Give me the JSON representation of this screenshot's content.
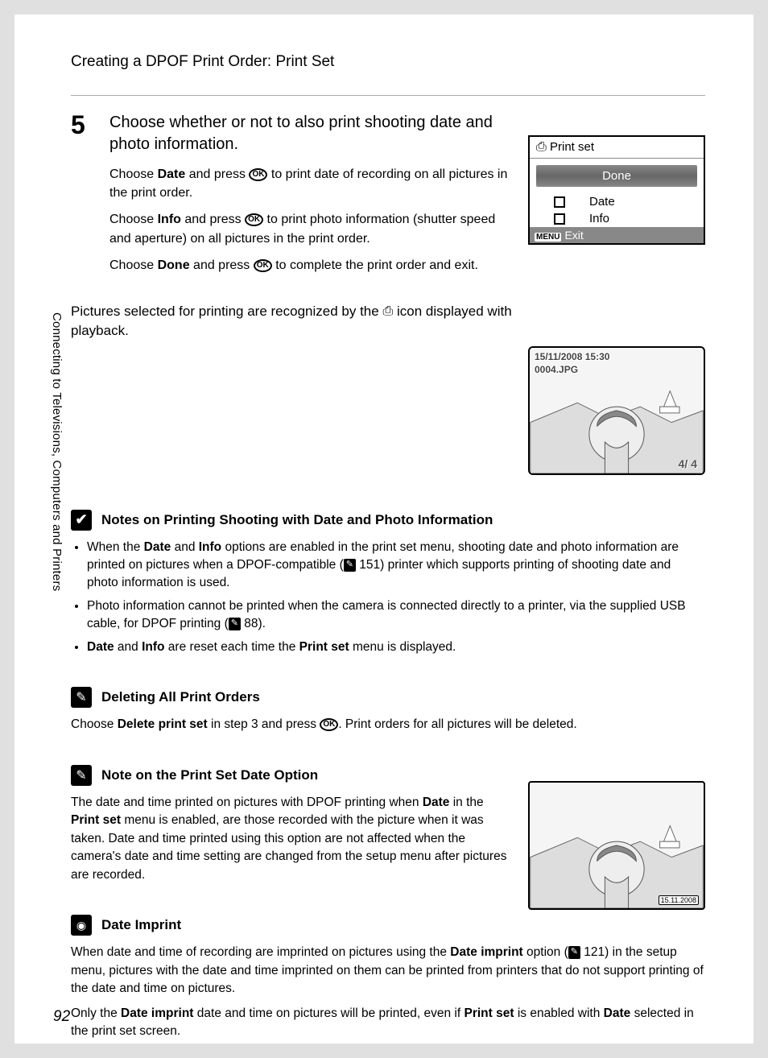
{
  "header": {
    "title": "Creating a DPOF Print Order: Print Set"
  },
  "sidebar": {
    "label": "Connecting to Televisions, Computers and Printers"
  },
  "step": {
    "number": "5",
    "title": "Choose whether or not to also print shooting date and photo information.",
    "p1_a": "Choose ",
    "p1_b": "Date",
    "p1_c": " and press ",
    "p1_d": " to print date of recording on all pictures in the print order.",
    "p2_a": "Choose ",
    "p2_b": "Info",
    "p2_c": " and press ",
    "p2_d": " to print photo information (shutter speed and aperture) on all pictures in the print order.",
    "p3_a": "Choose ",
    "p3_b": "Done",
    "p3_c": " and press ",
    "p3_d": " to complete the print order and exit."
  },
  "mini": {
    "title": "Print set",
    "done": "Done",
    "date": "Date",
    "info": "Info",
    "exit": "Exit",
    "menu": "MENU"
  },
  "playback_text_a": "Pictures selected for printing are recognized by the ",
  "playback_text_b": " icon displayed with playback.",
  "playback_overlay": {
    "date": "15/11/2008 15:30",
    "file": "0004.JPG",
    "counter": "4/    4"
  },
  "notes1": {
    "heading": "Notes on Printing Shooting with Date and Photo Information",
    "li1_a": "When the ",
    "li1_b": "Date",
    "li1_c": " and ",
    "li1_d": "Info",
    "li1_e": " options are enabled in the print set menu, shooting date and photo information are printed on pictures when a DPOF-compatible (",
    "li1_ref": "151",
    "li1_f": ") printer which supports printing of shooting date and photo information is used.",
    "li2_a": "Photo information cannot be printed when the camera is connected directly to a printer, via the supplied USB cable, for DPOF printing (",
    "li2_ref": "88",
    "li2_b": ").",
    "li3_a": "Date",
    "li3_b": " and ",
    "li3_c": "Info",
    "li3_d": " are reset each time the ",
    "li3_e": "Print set",
    "li3_f": " menu is displayed."
  },
  "notes2": {
    "heading": "Deleting All Print Orders",
    "p_a": "Choose ",
    "p_b": "Delete print set",
    "p_c": " in step 3 and press ",
    "p_d": ". Print orders for all pictures will be deleted."
  },
  "notes3": {
    "heading": "Note on the Print Set Date Option",
    "p_a": "The date and time printed on pictures with DPOF printing when ",
    "p_b": "Date",
    "p_c": " in the ",
    "p_d": "Print set",
    "p_e": " menu is enabled, are those recorded with the picture when it was taken. Date and time printed using this option are not affected when the camera's date and time setting are changed from the setup menu after pictures are recorded."
  },
  "notes4": {
    "heading": "Date Imprint",
    "p1_a": "When date and time of recording are imprinted on pictures using the ",
    "p1_b": "Date imprint",
    "p1_c": " option (",
    "p1_ref": "121",
    "p1_d": ") in the setup menu, pictures with the date and time imprinted on them can be printed from printers that do not support printing of the date and time on pictures.",
    "p2_a": "Only the ",
    "p2_b": "Date imprint",
    "p2_c": " date and time on pictures will be printed, even if ",
    "p2_d": "Print set",
    "p2_e": " is enabled with ",
    "p2_f": "Date",
    "p2_g": " selected in the print set screen."
  },
  "imprint_date": "15.11.2008",
  "page_number": "92",
  "icons": {
    "ok": "OK",
    "print": "⎙"
  }
}
